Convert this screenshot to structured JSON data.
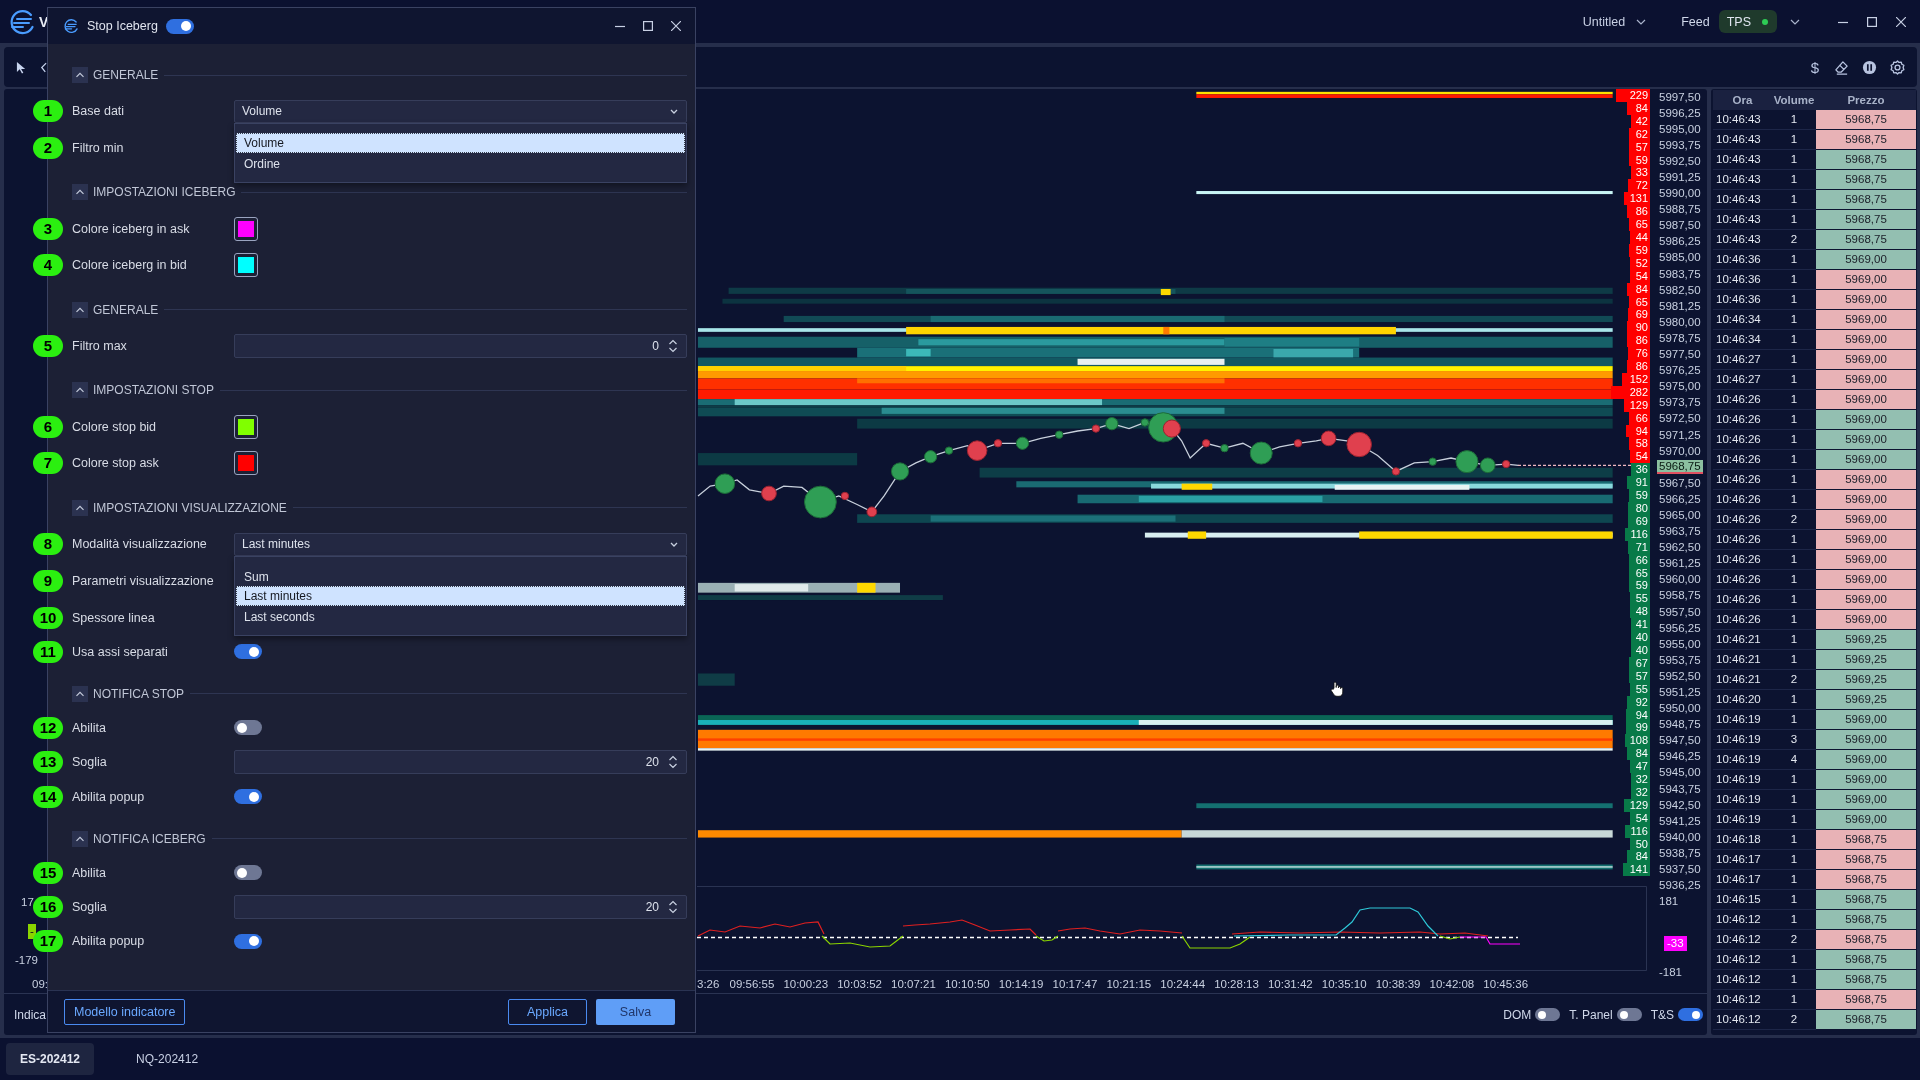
{
  "app_bar": {
    "app_name": "V",
    "layout": "Untitled",
    "feed_label": "Feed",
    "feed": "TPS",
    "feed_connected": true
  },
  "dialog": {
    "title": "Stop Iceberg",
    "enabled": true,
    "sections": [
      {
        "title": "GENERALE",
        "expanded": true,
        "rows": [
          {
            "number": "1",
            "label": "Base dati",
            "kind": "select",
            "value": "Volume",
            "open": true,
            "options": [
              {
                "label": "Volume",
                "selected": true
              },
              {
                "label": "Ordine",
                "selected": false
              }
            ]
          },
          {
            "number": "2",
            "label": "Filtro min",
            "kind": "covered"
          }
        ]
      },
      {
        "title": "IMPOSTAZIONI ICEBERG",
        "expanded": true,
        "rows": [
          {
            "number": "3",
            "label": "Colore iceberg in ask",
            "kind": "color",
            "color": "#ff00ff"
          },
          {
            "number": "4",
            "label": "Colore iceberg in bid",
            "kind": "color",
            "color": "#00ffff"
          }
        ]
      },
      {
        "title": "GENERALE",
        "expanded": true,
        "rows": [
          {
            "number": "5",
            "label": "Filtro max",
            "kind": "number",
            "value": "0"
          }
        ]
      },
      {
        "title": "IMPOSTAZIONI STOP",
        "expanded": true,
        "rows": [
          {
            "number": "6",
            "label": "Colore stop bid",
            "kind": "color",
            "color": "#80ff00"
          },
          {
            "number": "7",
            "label": "Colore stop ask",
            "kind": "color",
            "color": "#ff0000"
          }
        ]
      },
      {
        "title": "IMPOSTAZIONI VISUALIZZAZIONE",
        "expanded": true,
        "rows": [
          {
            "number": "8",
            "label": "Modalità visualizzazione",
            "kind": "select",
            "value": "Last minutes",
            "open": true,
            "options": [
              {
                "label": "Sum",
                "selected": false
              },
              {
                "label": "Last minutes",
                "selected": true
              },
              {
                "label": "Last seconds",
                "selected": false
              }
            ]
          },
          {
            "number": "9",
            "label": "Parametri visualizzazione",
            "kind": "covered"
          },
          {
            "number": "10",
            "label": "Spessore linea",
            "kind": "covered"
          },
          {
            "number": "11",
            "label": "Usa assi separati",
            "kind": "toggle",
            "on": true
          }
        ]
      },
      {
        "title": "NOTIFICA STOP",
        "expanded": true,
        "rows": [
          {
            "number": "12",
            "label": "Abilita",
            "kind": "toggle",
            "on": false
          },
          {
            "number": "13",
            "label": "Soglia",
            "kind": "number",
            "value": "20"
          },
          {
            "number": "14",
            "label": "Abilita popup",
            "kind": "toggle",
            "on": true
          }
        ]
      },
      {
        "title": "NOTIFICA ICEBERG",
        "expanded": true,
        "rows": [
          {
            "number": "15",
            "label": "Abilita",
            "kind": "toggle",
            "on": false
          },
          {
            "number": "16",
            "label": "Soglia",
            "kind": "number",
            "value": "20"
          },
          {
            "number": "17",
            "label": "Abilita popup",
            "kind": "toggle",
            "on": true
          }
        ]
      }
    ],
    "footer": {
      "template_button": "Modello indicatore",
      "apply_button": "Applica",
      "save_button": "Salva"
    }
  },
  "chart_toolbar": {
    "currency_symbol": "$"
  },
  "chart": {
    "price_labels": [
      {
        "price": "5997,50",
        "current": false
      },
      {
        "price": "5996,25",
        "current": false
      },
      {
        "price": "5995,00",
        "current": false
      },
      {
        "price": "5993,75",
        "current": false
      },
      {
        "price": "5992,50",
        "current": false
      },
      {
        "price": "5991,25",
        "current": false
      },
      {
        "price": "5990,00",
        "current": false
      },
      {
        "price": "5988,75",
        "current": false
      },
      {
        "price": "5987,50",
        "current": false
      },
      {
        "price": "5986,25",
        "current": false
      },
      {
        "price": "5985,00",
        "current": false
      },
      {
        "price": "5983,75",
        "current": false
      },
      {
        "price": "5982,50",
        "current": false
      },
      {
        "price": "5981,25",
        "current": false
      },
      {
        "price": "5980,00",
        "current": false
      },
      {
        "price": "5978,75",
        "current": false
      },
      {
        "price": "5977,50",
        "current": false
      },
      {
        "price": "5976,25",
        "current": false
      },
      {
        "price": "5975,00",
        "current": false
      },
      {
        "price": "5973,75",
        "current": false
      },
      {
        "price": "5972,50",
        "current": false
      },
      {
        "price": "5971,25",
        "current": false
      },
      {
        "price": "5970,00",
        "current": false
      },
      {
        "price": "5968,75",
        "current": true
      },
      {
        "price": "5967,50",
        "current": false
      },
      {
        "price": "5966,25",
        "current": false
      },
      {
        "price": "5965,00",
        "current": false
      },
      {
        "price": "5963,75",
        "current": false
      },
      {
        "price": "5962,50",
        "current": false
      },
      {
        "price": "5961,25",
        "current": false
      },
      {
        "price": "5960,00",
        "current": false
      },
      {
        "price": "5958,75",
        "current": false
      },
      {
        "price": "5957,50",
        "current": false
      },
      {
        "price": "5956,25",
        "current": false
      },
      {
        "price": "5955,00",
        "current": false
      },
      {
        "price": "5953,75",
        "current": false
      },
      {
        "price": "5952,50",
        "current": false
      },
      {
        "price": "5951,25",
        "current": false
      },
      {
        "price": "5950,00",
        "current": false
      },
      {
        "price": "5948,75",
        "current": false
      },
      {
        "price": "5947,50",
        "current": false
      },
      {
        "price": "5946,25",
        "current": false
      },
      {
        "price": "5945,00",
        "current": false
      },
      {
        "price": "5943,75",
        "current": false
      },
      {
        "price": "5942,50",
        "current": false
      },
      {
        "price": "5941,25",
        "current": false
      },
      {
        "price": "5940,00",
        "current": false
      },
      {
        "price": "5938,75",
        "current": false
      },
      {
        "price": "5937,50",
        "current": false
      },
      {
        "price": "5936,25",
        "current": false
      }
    ],
    "volume_profile": [
      {
        "value": "229",
        "color": "#ff0000"
      },
      {
        "value": "84",
        "color": "#ff0000"
      },
      {
        "value": "42",
        "color": "#ff0000"
      },
      {
        "value": "62",
        "color": "#ff0000"
      },
      {
        "value": "57",
        "color": "#ff0000"
      },
      {
        "value": "59",
        "color": "#ff0000"
      },
      {
        "value": "33",
        "color": "#ff0000"
      },
      {
        "value": "72",
        "color": "#ff0000"
      },
      {
        "value": "131",
        "color": "#ff0000"
      },
      {
        "value": "86",
        "color": "#ff0000"
      },
      {
        "value": "65",
        "color": "#ff0000"
      },
      {
        "value": "44",
        "color": "#ff0000"
      },
      {
        "value": "59",
        "color": "#ff0000"
      },
      {
        "value": "52",
        "color": "#ff0000"
      },
      {
        "value": "54",
        "color": "#ff0000"
      },
      {
        "value": "84",
        "color": "#ff0000"
      },
      {
        "value": "65",
        "color": "#ff0000"
      },
      {
        "value": "69",
        "color": "#ff0000"
      },
      {
        "value": "90",
        "color": "#ff0000"
      },
      {
        "value": "86",
        "color": "#ff0000"
      },
      {
        "value": "76",
        "color": "#ff0000"
      },
      {
        "value": "86",
        "color": "#ff0000"
      },
      {
        "value": "152",
        "color": "#ff0000"
      },
      {
        "value": "282",
        "color": "#ff0000"
      },
      {
        "value": "129",
        "color": "#ff0000"
      },
      {
        "value": "66",
        "color": "#ff0000"
      },
      {
        "value": "94",
        "color": "#ff0000"
      },
      {
        "value": "58",
        "color": "#ff0000"
      },
      {
        "value": "54",
        "color": "#ff0000"
      },
      {
        "value": "36",
        "color": "#087a48"
      },
      {
        "value": "91",
        "color": "#087a48"
      },
      {
        "value": "59",
        "color": "#087a48"
      },
      {
        "value": "80",
        "color": "#087a48"
      },
      {
        "value": "69",
        "color": "#087a48"
      },
      {
        "value": "116",
        "color": "#087a48"
      },
      {
        "value": "71",
        "color": "#087a48"
      },
      {
        "value": "66",
        "color": "#087a48"
      },
      {
        "value": "65",
        "color": "#087a48"
      },
      {
        "value": "59",
        "color": "#087a48"
      },
      {
        "value": "55",
        "color": "#087a48"
      },
      {
        "value": "48",
        "color": "#087a48"
      },
      {
        "value": "41",
        "color": "#087a48"
      },
      {
        "value": "40",
        "color": "#087a48"
      },
      {
        "value": "40",
        "color": "#087a48"
      },
      {
        "value": "67",
        "color": "#087a48"
      },
      {
        "value": "57",
        "color": "#087a48"
      },
      {
        "value": "55",
        "color": "#087a48"
      },
      {
        "value": "92",
        "color": "#087a48"
      },
      {
        "value": "94",
        "color": "#087a48"
      },
      {
        "value": "99",
        "color": "#087a48"
      },
      {
        "value": "108",
        "color": "#087a48"
      },
      {
        "value": "84",
        "color": "#087a48"
      },
      {
        "value": "47",
        "color": "#087a48"
      },
      {
        "value": "32",
        "color": "#087a48"
      },
      {
        "value": "32",
        "color": "#087a48"
      },
      {
        "value": "129",
        "color": "#087a48"
      },
      {
        "value": "54",
        "color": "#087a48"
      },
      {
        "value": "116",
        "color": "#087a48"
      },
      {
        "value": "50",
        "color": "#087a48"
      },
      {
        "value": "84",
        "color": "#087a48"
      },
      {
        "value": "141",
        "color": "#087a48"
      }
    ],
    "indicator_axis": {
      "max": "181",
      "current": "-33",
      "min": "-181"
    },
    "left_axis": {
      "max": "17",
      "current": "-",
      "min": "-179",
      "time": "09:"
    },
    "time_labels": [
      "3:26",
      "09:56:55",
      "10:00:23",
      "10:03:52",
      "10:07:21",
      "10:10:50",
      "10:14:19",
      "10:17:47",
      "10:21:15",
      "10:24:44",
      "10:28:13",
      "10:31:42",
      "10:35:10",
      "10:38:39",
      "10:42:08",
      "10:45:36"
    ]
  },
  "chart_controls": {
    "indicators_label": "Indica",
    "toggles": [
      {
        "label": "DOM",
        "on": false
      },
      {
        "label": "T. Panel",
        "on": false
      },
      {
        "label": "T&S",
        "on": true
      }
    ]
  },
  "time_sales": {
    "columns": [
      "Ora",
      "Volume",
      "Prezzo"
    ],
    "rows": [
      {
        "time": "10:46:43",
        "volume": "1",
        "price": "5968,75",
        "color": "#e8b2b6"
      },
      {
        "time": "10:46:43",
        "volume": "1",
        "price": "5968,75",
        "color": "#e8b2b6"
      },
      {
        "time": "10:46:43",
        "volume": "1",
        "price": "5968,75",
        "color": "#93bfb1"
      },
      {
        "time": "10:46:43",
        "volume": "1",
        "price": "5968,75",
        "color": "#93bfb1"
      },
      {
        "time": "10:46:43",
        "volume": "1",
        "price": "5968,75",
        "color": "#93bfb1"
      },
      {
        "time": "10:46:43",
        "volume": "1",
        "price": "5968,75",
        "color": "#93bfb1"
      },
      {
        "time": "10:46:43",
        "volume": "2",
        "price": "5968,75",
        "color": "#93bfb1"
      },
      {
        "time": "10:46:36",
        "volume": "1",
        "price": "5969,00",
        "color": "#93bfb1"
      },
      {
        "time": "10:46:36",
        "volume": "1",
        "price": "5969,00",
        "color": "#e8b2b6"
      },
      {
        "time": "10:46:36",
        "volume": "1",
        "price": "5969,00",
        "color": "#e8b2b6"
      },
      {
        "time": "10:46:34",
        "volume": "1",
        "price": "5969,00",
        "color": "#e8b2b6"
      },
      {
        "time": "10:46:34",
        "volume": "1",
        "price": "5969,00",
        "color": "#e8b2b6"
      },
      {
        "time": "10:46:27",
        "volume": "1",
        "price": "5969,00",
        "color": "#e8b2b6"
      },
      {
        "time": "10:46:27",
        "volume": "1",
        "price": "5969,00",
        "color": "#e8b2b6"
      },
      {
        "time": "10:46:26",
        "volume": "1",
        "price": "5969,00",
        "color": "#e8b2b6"
      },
      {
        "time": "10:46:26",
        "volume": "1",
        "price": "5969,00",
        "color": "#93bfb1"
      },
      {
        "time": "10:46:26",
        "volume": "1",
        "price": "5969,00",
        "color": "#93bfb1"
      },
      {
        "time": "10:46:26",
        "volume": "1",
        "price": "5969,00",
        "color": "#93bfb1"
      },
      {
        "time": "10:46:26",
        "volume": "1",
        "price": "5969,00",
        "color": "#e8b2b6"
      },
      {
        "time": "10:46:26",
        "volume": "1",
        "price": "5969,00",
        "color": "#e8b2b6"
      },
      {
        "time": "10:46:26",
        "volume": "2",
        "price": "5969,00",
        "color": "#e8b2b6"
      },
      {
        "time": "10:46:26",
        "volume": "1",
        "price": "5969,00",
        "color": "#e8b2b6"
      },
      {
        "time": "10:46:26",
        "volume": "1",
        "price": "5969,00",
        "color": "#e8b2b6"
      },
      {
        "time": "10:46:26",
        "volume": "1",
        "price": "5969,00",
        "color": "#e8b2b6"
      },
      {
        "time": "10:46:26",
        "volume": "1",
        "price": "5969,00",
        "color": "#e8b2b6"
      },
      {
        "time": "10:46:26",
        "volume": "1",
        "price": "5969,00",
        "color": "#e8b2b6"
      },
      {
        "time": "10:46:21",
        "volume": "1",
        "price": "5969,25",
        "color": "#93bfb1"
      },
      {
        "time": "10:46:21",
        "volume": "1",
        "price": "5969,25",
        "color": "#93bfb1"
      },
      {
        "time": "10:46:21",
        "volume": "2",
        "price": "5969,25",
        "color": "#93bfb1"
      },
      {
        "time": "10:46:20",
        "volume": "1",
        "price": "5969,25",
        "color": "#93bfb1"
      },
      {
        "time": "10:46:19",
        "volume": "1",
        "price": "5969,00",
        "color": "#93bfb1"
      },
      {
        "time": "10:46:19",
        "volume": "3",
        "price": "5969,00",
        "color": "#93bfb1"
      },
      {
        "time": "10:46:19",
        "volume": "4",
        "price": "5969,00",
        "color": "#93bfb1"
      },
      {
        "time": "10:46:19",
        "volume": "1",
        "price": "5969,00",
        "color": "#93bfb1"
      },
      {
        "time": "10:46:19",
        "volume": "1",
        "price": "5969,00",
        "color": "#93bfb1"
      },
      {
        "time": "10:46:19",
        "volume": "1",
        "price": "5969,00",
        "color": "#93bfb1"
      },
      {
        "time": "10:46:18",
        "volume": "1",
        "price": "5968,75",
        "color": "#e8b2b6"
      },
      {
        "time": "10:46:17",
        "volume": "1",
        "price": "5968,75",
        "color": "#e8b2b6"
      },
      {
        "time": "10:46:17",
        "volume": "1",
        "price": "5968,75",
        "color": "#e8b2b6"
      },
      {
        "time": "10:46:15",
        "volume": "1",
        "price": "5968,75",
        "color": "#93bfb1"
      },
      {
        "time": "10:46:12",
        "volume": "1",
        "price": "5968,75",
        "color": "#93bfb1"
      },
      {
        "time": "10:46:12",
        "volume": "2",
        "price": "5968,75",
        "color": "#e8b2b6"
      },
      {
        "time": "10:46:12",
        "volume": "1",
        "price": "5968,75",
        "color": "#93bfb1"
      },
      {
        "time": "10:46:12",
        "volume": "1",
        "price": "5968,75",
        "color": "#93bfb1"
      },
      {
        "time": "10:46:12",
        "volume": "1",
        "price": "5968,75",
        "color": "#e8b2b6"
      },
      {
        "time": "10:46:12",
        "volume": "2",
        "price": "5968,75",
        "color": "#93bfb1"
      }
    ]
  },
  "tabs": [
    {
      "label": "ES-202412",
      "selected": true
    },
    {
      "label": "NQ-202412",
      "selected": false
    }
  ]
}
